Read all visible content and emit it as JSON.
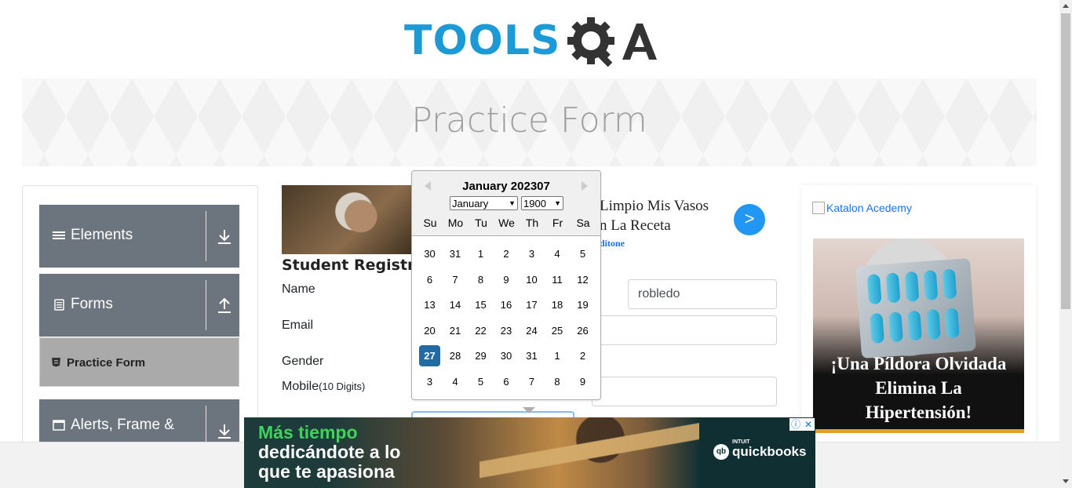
{
  "header": {
    "logo_text": "TOOLS",
    "logo_suffix": "QA"
  },
  "banner": {
    "title": "Practice Form"
  },
  "sidebar": {
    "groups": [
      {
        "label": "Elements",
        "arrow": "download-icon"
      },
      {
        "label": "Forms",
        "arrow": "upload-icon"
      },
      {
        "label": "Alerts, Frame &",
        "arrow": "download-icon"
      }
    ],
    "active_item": "Practice Form"
  },
  "form": {
    "title": "Student Registratio",
    "name_label": "Name",
    "last_name_value": "robledo",
    "email_label": "Email",
    "gender_label": "Gender",
    "mobile_label": "Mobile",
    "mobile_hint": "(10 Digits)"
  },
  "inline_ad": {
    "line1": "Limpio Mis Vasos",
    "line2": "n La Receta",
    "source": "ditone",
    "next": ">"
  },
  "datepicker": {
    "header": "January 202307",
    "month_select": "January",
    "year_select": "1900",
    "day_names": [
      "Su",
      "Mo",
      "Tu",
      "We",
      "Th",
      "Fr",
      "Sa"
    ],
    "weeks": [
      [
        "30",
        "31",
        "1",
        "2",
        "3",
        "4",
        "5"
      ],
      [
        "6",
        "7",
        "8",
        "9",
        "10",
        "11",
        "12"
      ],
      [
        "13",
        "14",
        "15",
        "16",
        "17",
        "18",
        "19"
      ],
      [
        "20",
        "21",
        "22",
        "23",
        "24",
        "25",
        "26"
      ],
      [
        "27",
        "28",
        "29",
        "30",
        "31",
        "1",
        "2"
      ],
      [
        "3",
        "4",
        "5",
        "6",
        "7",
        "8",
        "9"
      ]
    ],
    "selected_day": "27"
  },
  "right_ad": {
    "katalon_alt": "Katalon Acedemy",
    "pill_line1": "¡Una Píldora Olvidada",
    "pill_line2": "Elimina La",
    "pill_line3": "Hipertensión!"
  },
  "bottom_ad": {
    "line1": "Más tiempo",
    "line2": "dedicándote a lo",
    "line3": "que te apasiona",
    "brand_small": "INTUIT",
    "brand": "quickbooks",
    "info_icon": "ⓘ",
    "close_icon": "✕"
  },
  "colors": {
    "accent": "#1b9ad6",
    "sidebar_group": "#6c757d",
    "datepicker_selected": "#216ba5",
    "ad_button": "#2196f3"
  }
}
